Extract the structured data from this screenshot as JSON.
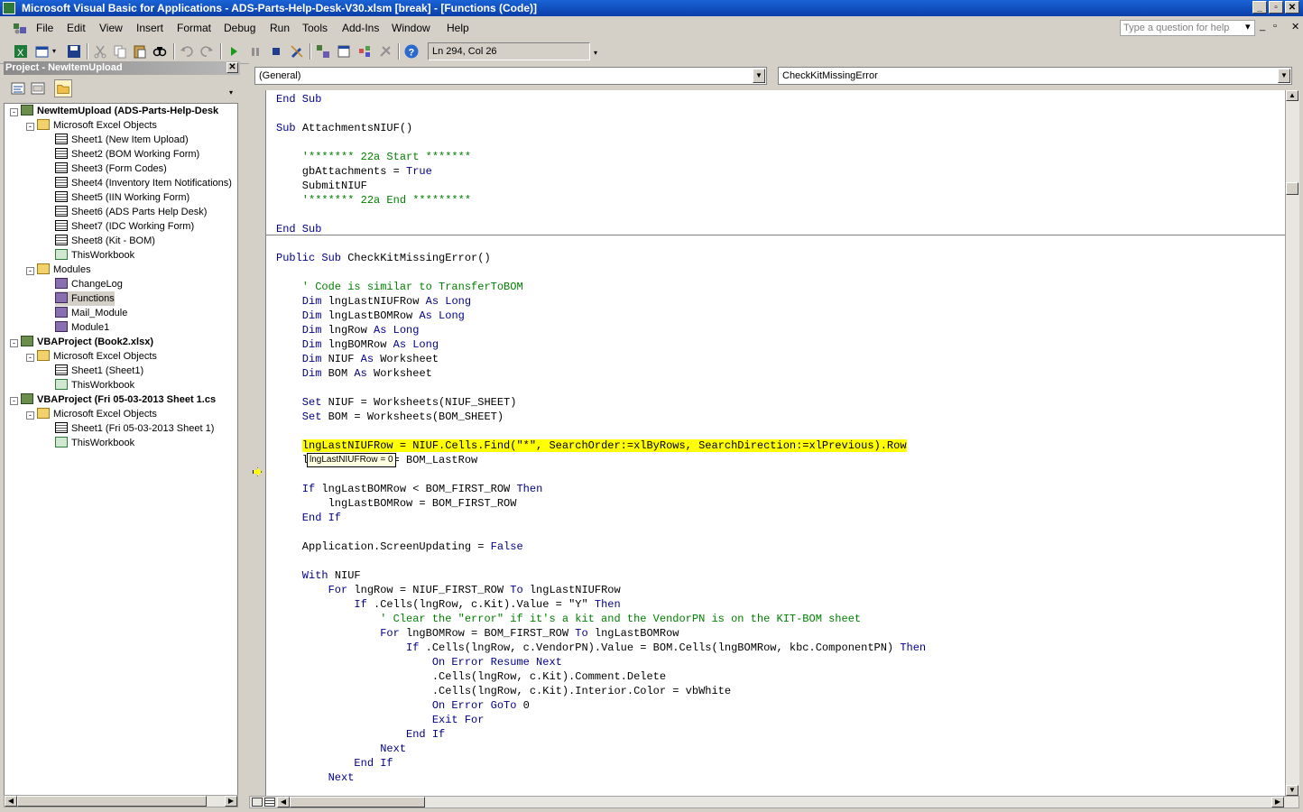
{
  "window": {
    "title": "Microsoft Visual Basic for Applications - ADS-Parts-Help-Desk-V30.xlsm [break] - [Functions (Code)]",
    "min_label": "_",
    "max_label": "▫",
    "close_label": "✕"
  },
  "menu": {
    "items": [
      "File",
      "Edit",
      "View",
      "Insert",
      "Format",
      "Debug",
      "Run",
      "Tools",
      "Add-Ins",
      "Window",
      "Help"
    ],
    "help_placeholder": "Type a question for help",
    "mdi_min": "_",
    "mdi_restore": "▫",
    "mdi_close": "✕"
  },
  "toolbar": {
    "position": "Ln 294, Col 26"
  },
  "project": {
    "title": "Project - NewItemUpload",
    "close_label": "✕",
    "tree": [
      {
        "label": "NewItemUpload (ADS-Parts-Help-Desk",
        "icon": "project-icon",
        "level": 0,
        "bold": true,
        "expander": "-"
      },
      {
        "label": "Microsoft Excel Objects",
        "icon": "folder-icon",
        "level": 1,
        "expander": "-"
      },
      {
        "label": "Sheet1 (New Item Upload)",
        "icon": "sheet-icon",
        "level": 2
      },
      {
        "label": "Sheet2 (BOM Working Form)",
        "icon": "sheet-icon",
        "level": 2
      },
      {
        "label": "Sheet3 (Form Codes)",
        "icon": "sheet-icon",
        "level": 2
      },
      {
        "label": "Sheet4 (Inventory Item Notifications)",
        "icon": "sheet-icon",
        "level": 2
      },
      {
        "label": "Sheet5 (IIN Working Form)",
        "icon": "sheet-icon",
        "level": 2
      },
      {
        "label": "Sheet6 (ADS Parts Help Desk)",
        "icon": "sheet-icon",
        "level": 2
      },
      {
        "label": "Sheet7 (IDC Working Form)",
        "icon": "sheet-icon",
        "level": 2
      },
      {
        "label": "Sheet8 (Kit - BOM)",
        "icon": "sheet-icon",
        "level": 2
      },
      {
        "label": "ThisWorkbook",
        "icon": "workbook-icon",
        "level": 2
      },
      {
        "label": "Modules",
        "icon": "folder-icon",
        "level": 1,
        "expander": "-"
      },
      {
        "label": "ChangeLog",
        "icon": "module-icon",
        "level": 2
      },
      {
        "label": "Functions",
        "icon": "module-icon",
        "level": 2,
        "selected": true
      },
      {
        "label": "Mail_Module",
        "icon": "module-icon",
        "level": 2
      },
      {
        "label": "Module1",
        "icon": "module-icon",
        "level": 2
      },
      {
        "label": "VBAProject (Book2.xlsx)",
        "icon": "project-icon",
        "level": 0,
        "bold": true,
        "expander": "-"
      },
      {
        "label": "Microsoft Excel Objects",
        "icon": "folder-icon",
        "level": 1,
        "expander": "-"
      },
      {
        "label": "Sheet1 (Sheet1)",
        "icon": "sheet-icon",
        "level": 2
      },
      {
        "label": "ThisWorkbook",
        "icon": "workbook-icon",
        "level": 2
      },
      {
        "label": "VBAProject (Fri 05-03-2013  Sheet 1.cs",
        "icon": "project-icon",
        "level": 0,
        "bold": true,
        "expander": "-"
      },
      {
        "label": "Microsoft Excel Objects",
        "icon": "folder-icon",
        "level": 1,
        "expander": "-"
      },
      {
        "label": "Sheet1 (Fri 05-03-2013  Sheet 1)",
        "icon": "sheet-icon",
        "level": 2
      },
      {
        "label": "ThisWorkbook",
        "icon": "workbook-icon",
        "level": 2
      }
    ]
  },
  "code": {
    "object_combo": "(General)",
    "proc_combo": "CheckKitMissingError",
    "tooltip": "lngLastNIUFRow = 0",
    "lines": [
      [
        [
          "kw",
          "End Sub"
        ]
      ],
      [],
      [
        [
          "kw",
          "Sub "
        ],
        [
          "",
          "AttachmentsNIUF()"
        ]
      ],
      [],
      [
        [
          "cm",
          "    '******* 22a Start *******"
        ]
      ],
      [
        [
          "",
          "    gbAttachments = "
        ],
        [
          "kw",
          "True"
        ]
      ],
      [
        [
          "",
          "    SubmitNIUF"
        ]
      ],
      [
        [
          "cm",
          "    '******* 22a End *********"
        ]
      ],
      [],
      [
        [
          "kw",
          "End Sub"
        ]
      ],
      [],
      [
        [
          "kw",
          "Public Sub "
        ],
        [
          "",
          "CheckKitMissingError()"
        ]
      ],
      [],
      [
        [
          "cm",
          "    ' Code is similar to TransferToBOM"
        ]
      ],
      [
        [
          "kw",
          "    Dim "
        ],
        [
          "",
          "lngLastNIUFRow "
        ],
        [
          "kw",
          "As Long"
        ]
      ],
      [
        [
          "kw",
          "    Dim "
        ],
        [
          "",
          "lngLastBOMRow "
        ],
        [
          "kw",
          "As Long"
        ]
      ],
      [
        [
          "kw",
          "    Dim "
        ],
        [
          "",
          "lngRow "
        ],
        [
          "kw",
          "As Long"
        ]
      ],
      [
        [
          "kw",
          "    Dim "
        ],
        [
          "",
          "lngBOMRow "
        ],
        [
          "kw",
          "As Long"
        ]
      ],
      [
        [
          "kw",
          "    Dim "
        ],
        [
          "",
          "NIUF "
        ],
        [
          "kw",
          "As "
        ],
        [
          "",
          "Worksheet"
        ]
      ],
      [
        [
          "kw",
          "    Dim "
        ],
        [
          "",
          "BOM "
        ],
        [
          "kw",
          "As "
        ],
        [
          "",
          "Worksheet"
        ]
      ],
      [],
      [
        [
          "kw",
          "    Set "
        ],
        [
          "",
          "NIUF = Worksheets(NIUF_SHEET)"
        ]
      ],
      [
        [
          "kw",
          "    Set "
        ],
        [
          "",
          "BOM = Worksheets(BOM_SHEET)"
        ]
      ],
      [],
      [
        [
          "",
          "    "
        ],
        [
          "hl",
          "lngLastNIUFRow = NIUF.Cells.Find(\"*\", SearchOrder:=xlByRows, SearchDirection:=xlPrevious).Row"
        ]
      ],
      [
        [
          "",
          "    lngLastBOMRow = BOM_LastRow"
        ]
      ],
      [],
      [
        [
          "kw",
          "    If "
        ],
        [
          "",
          "lngLastBOMRow < BOM_FIRST_ROW "
        ],
        [
          "kw",
          "Then"
        ]
      ],
      [
        [
          "",
          "        lngLastBOMRow = BOM_FIRST_ROW"
        ]
      ],
      [
        [
          "kw",
          "    End If"
        ]
      ],
      [],
      [
        [
          "",
          "    Application.ScreenUpdating = "
        ],
        [
          "kw",
          "False"
        ]
      ],
      [],
      [
        [
          "kw",
          "    With "
        ],
        [
          "",
          "NIUF"
        ]
      ],
      [
        [
          "kw",
          "        For "
        ],
        [
          "",
          "lngRow = NIUF_FIRST_ROW "
        ],
        [
          "kw",
          "To "
        ],
        [
          "",
          "lngLastNIUFRow"
        ]
      ],
      [
        [
          "kw",
          "            If "
        ],
        [
          "",
          ".Cells(lngRow, c.Kit).Value = \"Y\" "
        ],
        [
          "kw",
          "Then"
        ]
      ],
      [
        [
          "cm",
          "                ' Clear the \"error\" if it's a kit and the VendorPN is on the KIT-BOM sheet"
        ]
      ],
      [
        [
          "kw",
          "                For "
        ],
        [
          "",
          "lngBOMRow = BOM_FIRST_ROW "
        ],
        [
          "kw",
          "To "
        ],
        [
          "",
          "lngLastBOMRow"
        ]
      ],
      [
        [
          "kw",
          "                    If "
        ],
        [
          "",
          ".Cells(lngRow, c.VendorPN).Value = BOM.Cells(lngBOMRow, kbc.ComponentPN) "
        ],
        [
          "kw",
          "Then"
        ]
      ],
      [
        [
          "kw",
          "                        On Error Resume Next"
        ]
      ],
      [
        [
          "",
          "                        .Cells(lngRow, c.Kit).Comment.Delete"
        ]
      ],
      [
        [
          "",
          "                        .Cells(lngRow, c.Kit).Interior.Color = vbWhite"
        ]
      ],
      [
        [
          "kw",
          "                        On Error GoTo "
        ],
        [
          "",
          "0"
        ]
      ],
      [
        [
          "kw",
          "                        Exit For"
        ]
      ],
      [
        [
          "kw",
          "                    End If"
        ]
      ],
      [
        [
          "kw",
          "                Next"
        ]
      ],
      [
        [
          "kw",
          "            End If"
        ]
      ],
      [
        [
          "kw",
          "        Next"
        ]
      ]
    ]
  }
}
